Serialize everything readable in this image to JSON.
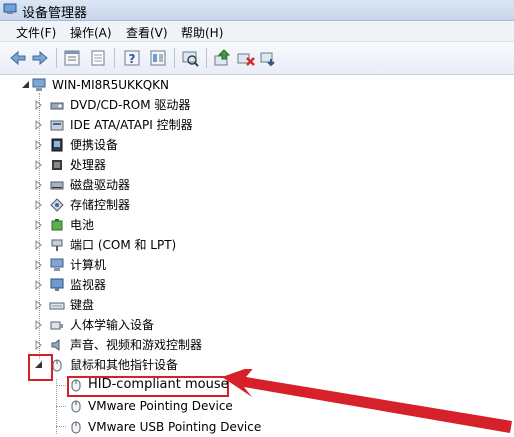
{
  "window": {
    "title": "设备管理器"
  },
  "menu": [
    "文件(F)",
    "操作(A)",
    "查看(V)",
    "帮助(H)"
  ],
  "toolbar_icons": [
    "back-arrow-icon",
    "forward-arrow-icon",
    "properties-icon",
    "list-icon",
    "help-icon",
    "view-icon",
    "scan-icon",
    "update-driver-icon",
    "disable-icon",
    "uninstall-icon"
  ],
  "tree": {
    "root": "WIN-MI8R5UKKQKN",
    "categories": [
      {
        "label": "DVD/CD-ROM 驱动器",
        "icon": "dvd-drive-icon"
      },
      {
        "label": "IDE ATA/ATAPI 控制器",
        "icon": "ide-controller-icon"
      },
      {
        "label": "便携设备",
        "icon": "portable-device-icon"
      },
      {
        "label": "处理器",
        "icon": "processor-icon"
      },
      {
        "label": "磁盘驱动器",
        "icon": "disk-drive-icon"
      },
      {
        "label": "存储控制器",
        "icon": "storage-controller-icon"
      },
      {
        "label": "电池",
        "icon": "battery-icon"
      },
      {
        "label": "端口 (COM 和 LPT)",
        "icon": "port-icon"
      },
      {
        "label": "计算机",
        "icon": "computer-icon"
      },
      {
        "label": "监视器",
        "icon": "monitor-icon"
      },
      {
        "label": "键盘",
        "icon": "keyboard-icon"
      },
      {
        "label": "人体学输入设备",
        "icon": "hid-icon"
      },
      {
        "label": "声音、视频和游戏控制器",
        "icon": "sound-icon"
      },
      {
        "label": "鼠标和其他指针设备",
        "icon": "mouse-icon",
        "expanded": true
      }
    ],
    "children": [
      {
        "label": "HID-compliant mouse"
      },
      {
        "label": "VMware Pointing Device"
      },
      {
        "label": "VMware USB Pointing Device"
      }
    ]
  },
  "colors": {
    "highlight": "#d6202a",
    "titlebar": "#c7d6ea"
  }
}
